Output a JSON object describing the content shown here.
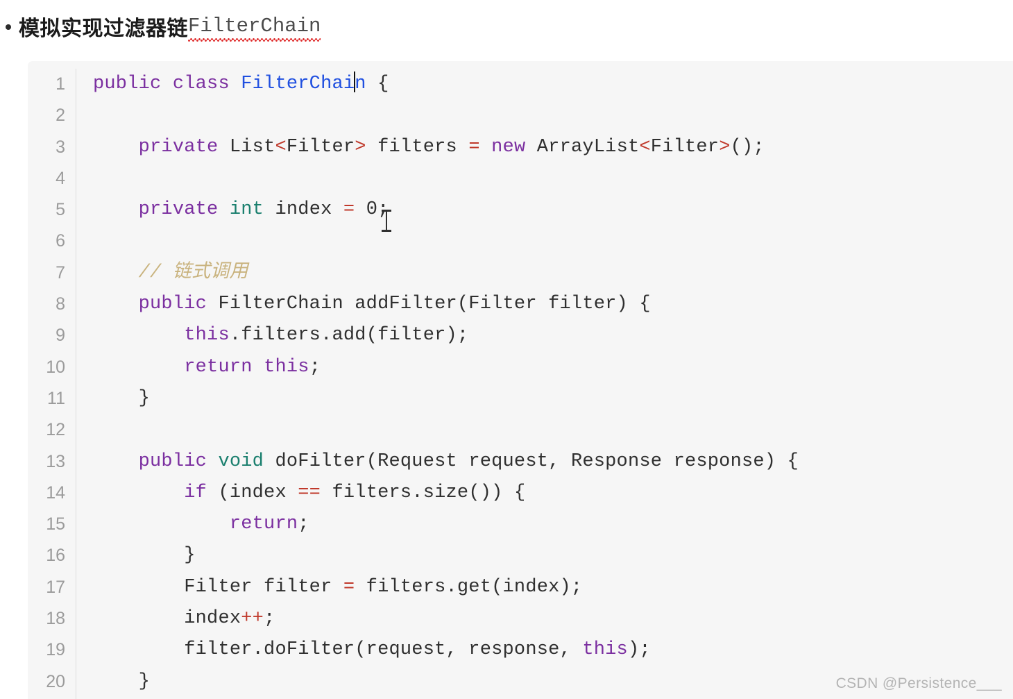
{
  "heading": {
    "bullet": "•",
    "text_cn": "模拟实现过滤器链",
    "text_code": "FilterChain",
    "misspelled": true,
    "underline_color": "#e03131"
  },
  "code_block": {
    "language": "java",
    "background": "#f6f6f6",
    "gutter_divider_color": "#dcdcdc",
    "line_numbers": [
      "1",
      "2",
      "3",
      "4",
      "5",
      "6",
      "7",
      "8",
      "9",
      "10",
      "11",
      "12",
      "13",
      "14",
      "15",
      "16",
      "17",
      "18",
      "19",
      "20"
    ],
    "caret": {
      "line": 1,
      "after_text": "public class FilterChai"
    },
    "mouse_cursor": {
      "type": "i-beam",
      "over_line": 3,
      "over_token": "Filter"
    },
    "lines": [
      {
        "n": "1",
        "text": "public class FilterChain {"
      },
      {
        "n": "2",
        "text": ""
      },
      {
        "n": "3",
        "text": "    private List<Filter> filters = new ArrayList<Filter>();"
      },
      {
        "n": "4",
        "text": ""
      },
      {
        "n": "5",
        "text": "    private int index = 0;"
      },
      {
        "n": "6",
        "text": ""
      },
      {
        "n": "7",
        "text": "    // 链式调用"
      },
      {
        "n": "8",
        "text": "    public FilterChain addFilter(Filter filter) {"
      },
      {
        "n": "9",
        "text": "        this.filters.add(filter);"
      },
      {
        "n": "10",
        "text": "        return this;"
      },
      {
        "n": "11",
        "text": "    }"
      },
      {
        "n": "12",
        "text": ""
      },
      {
        "n": "13",
        "text": "    public void doFilter(Request request, Response response) {"
      },
      {
        "n": "14",
        "text": "        if (index == filters.size()) {"
      },
      {
        "n": "15",
        "text": "            return;"
      },
      {
        "n": "16",
        "text": "        }"
      },
      {
        "n": "17",
        "text": "        Filter filter = filters.get(index);"
      },
      {
        "n": "18",
        "text": "        index++;"
      },
      {
        "n": "19",
        "text": "        filter.doFilter(request, response, this);"
      },
      {
        "n": "20",
        "text": "    }"
      }
    ],
    "token_colors": {
      "keyword": "#7b2fa0",
      "type": "#1a7f6e",
      "class_name": "#1f4fe0",
      "operator": "#c0392b",
      "comment": "#c9b37e",
      "plain": "#2f2f2f",
      "line_number": "#9b9b9b"
    }
  },
  "watermark": {
    "text": "CSDN @Persistence___"
  }
}
